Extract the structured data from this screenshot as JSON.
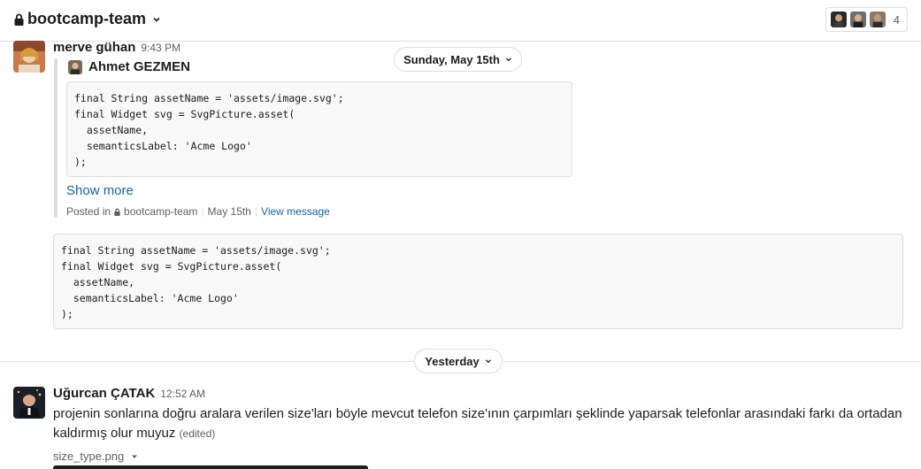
{
  "header": {
    "channel_name": "bootcamp-team",
    "lock_icon": "lock-icon",
    "member_count": "4"
  },
  "colors": {
    "link": "#1264a3",
    "border": "#dddddd",
    "text": "#1d1c1d",
    "muted": "#616061"
  },
  "messages": [
    {
      "author": "merve gühan",
      "time": "9:43 PM",
      "shared": {
        "author": "Ahmet GEZMEN",
        "code": "final String assetName = 'assets/image.svg';\nfinal Widget svg = SvgPicture.asset(\n  assetName,\n  semanticsLabel: 'Acme Logo'\n);",
        "show_more": "Show more",
        "posted_in": "Posted in",
        "channel": "bootcamp-team",
        "date": "May 15th",
        "view_message": "View message"
      },
      "code": "final String assetName = 'assets/image.svg';\nfinal Widget svg = SvgPicture.asset(\n  assetName,\n  semanticsLabel: 'Acme Logo'\n);"
    },
    {
      "author": "Uğurcan ÇATAK",
      "time": "12:52 AM",
      "text": "projenin sonlarına doğru aralara verilen size'ları böyle mevcut telefon size'ının çarpımları şeklinde yaparsak telefonlar arasındaki farkı da ortadan kaldırmış olur muyuz",
      "edited": "(edited)",
      "file_name": "size_type.png"
    }
  ],
  "date_dividers": {
    "first": "Sunday, May 15th",
    "second": "Yesterday"
  }
}
